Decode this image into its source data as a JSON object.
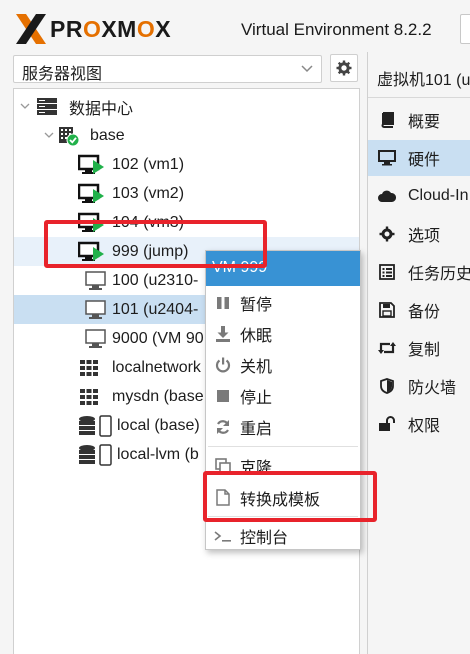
{
  "header": {
    "logo_text": "PROXMOX",
    "title": "Virtual Environment 8.2.2"
  },
  "view_selector": {
    "value": "服务器视图"
  },
  "tree": {
    "datacenter": "数据中心",
    "node": "base",
    "items": [
      {
        "label": "102 (vm1)",
        "type": "vm-running"
      },
      {
        "label": "103 (vm2)",
        "type": "vm-running"
      },
      {
        "label": "104 (vm3)",
        "type": "vm-running"
      },
      {
        "label": "999 (jump)",
        "type": "vm-running"
      },
      {
        "label": "100 (u2310-",
        "type": "vm-stopped"
      },
      {
        "label": "101 (u2404-",
        "type": "vm-stopped"
      },
      {
        "label": "9000 (VM 90",
        "type": "template"
      },
      {
        "label": "localnetwork",
        "type": "network"
      },
      {
        "label": "mysdn (base",
        "type": "network"
      },
      {
        "label": "local (base)",
        "type": "storage"
      },
      {
        "label": "local-lvm (b",
        "type": "storage"
      }
    ]
  },
  "context_menu": {
    "title": "VM 999",
    "items": [
      {
        "label": "暂停",
        "icon": "pause-icon"
      },
      {
        "label": "休眠",
        "icon": "download-icon"
      },
      {
        "label": "关机",
        "icon": "power-icon"
      },
      {
        "label": "停止",
        "icon": "stop-icon"
      },
      {
        "label": "重启",
        "icon": "refresh-icon"
      },
      {
        "label": "克隆",
        "icon": "clone-icon"
      },
      {
        "label": "转换成模板",
        "icon": "file-icon"
      },
      {
        "label": "控制台",
        "icon": "terminal-icon"
      }
    ]
  },
  "right_panel": {
    "title": "虚拟机101 (u",
    "nav": [
      {
        "label": "概要",
        "icon": "book-icon"
      },
      {
        "label": "硬件",
        "icon": "monitor-icon"
      },
      {
        "label": "Cloud-In",
        "icon": "cloud-icon"
      },
      {
        "label": "选项",
        "icon": "gear-icon"
      },
      {
        "label": "任务历史",
        "icon": "list-icon"
      },
      {
        "label": "备份",
        "icon": "floppy-icon"
      },
      {
        "label": "复制",
        "icon": "retweet-icon"
      },
      {
        "label": "防火墙",
        "icon": "shield-icon"
      },
      {
        "label": "权限",
        "icon": "unlock-icon"
      }
    ]
  },
  "colors": {
    "accent": "#3892d4",
    "brand_orange": "#e57000",
    "selection": "#c9dff2",
    "highlight_box": "#e8232b",
    "running_green": "#21b14a"
  }
}
